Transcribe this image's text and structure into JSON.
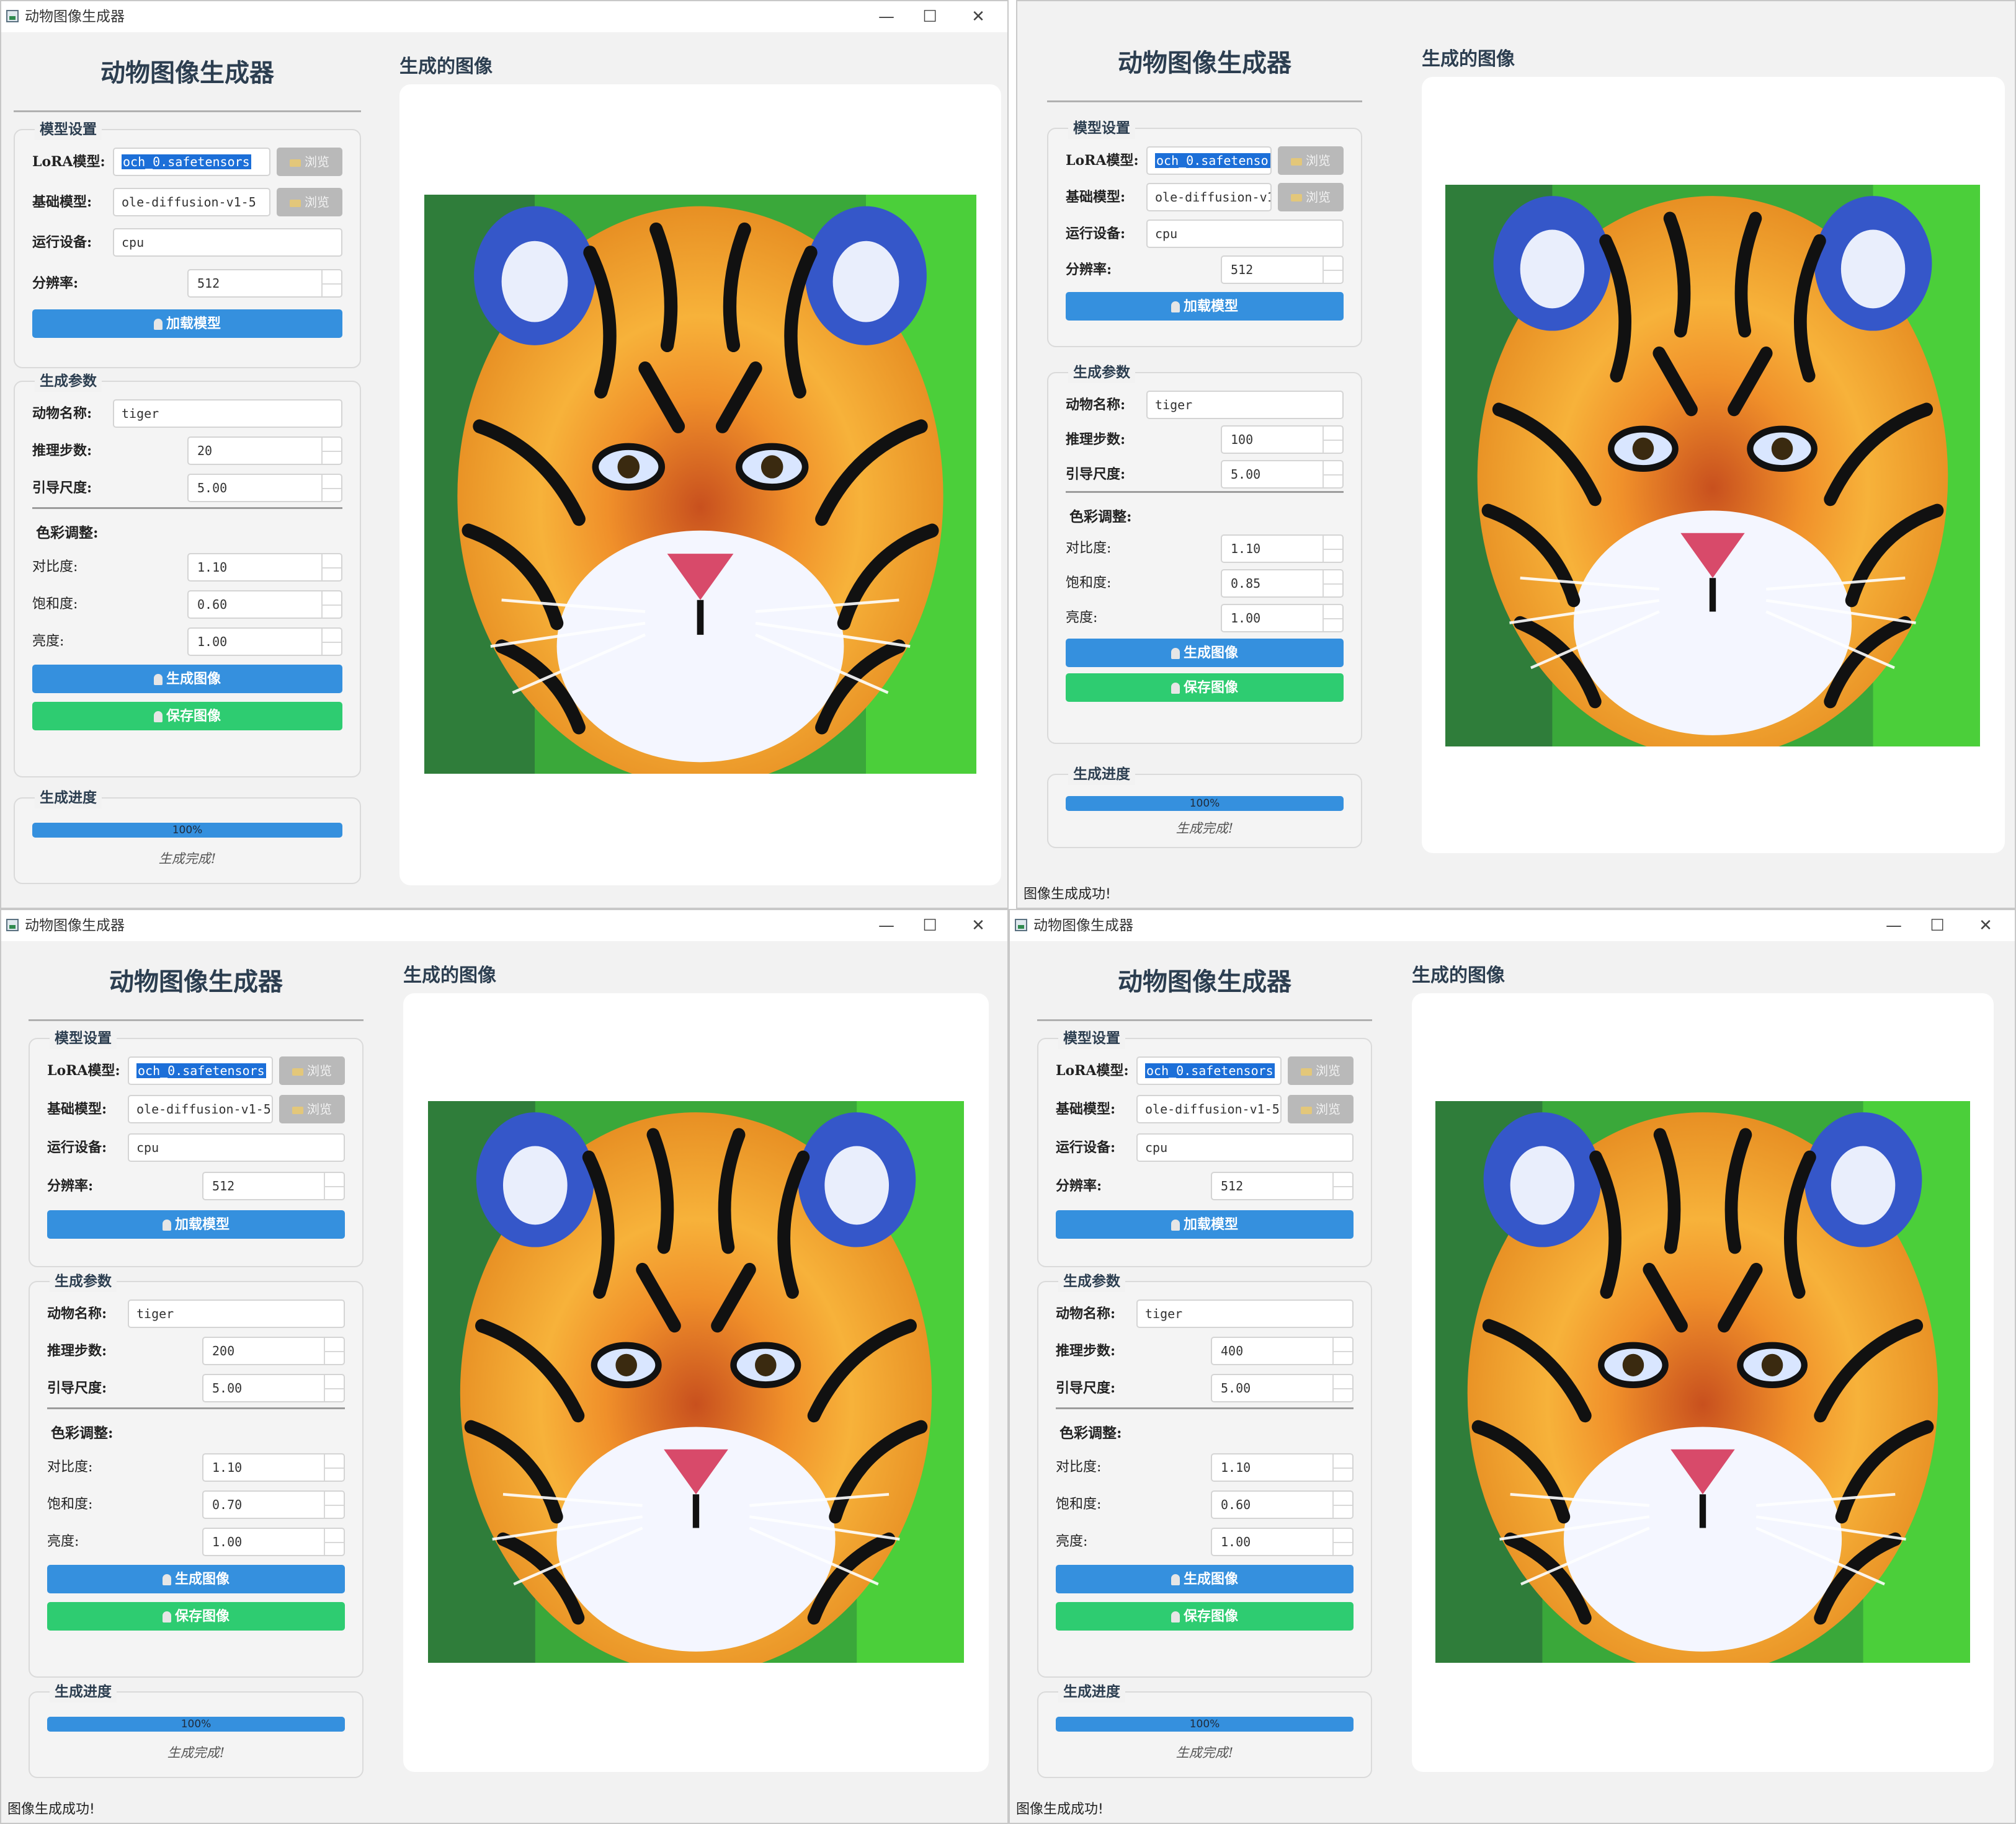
{
  "app": {
    "window_title": "动物图像生成器",
    "panel_title": "动物图像生成器",
    "image_title": "生成的图像",
    "minimize": "—",
    "maximize": "☐",
    "close": "✕"
  },
  "labels": {
    "model_group": "模型设置",
    "lora": "LoRA模型:",
    "base": "基础模型:",
    "device": "运行设备:",
    "resolution": "分辨率:",
    "browse": "浏览",
    "load_model": "加载模型",
    "gen_group": "生成参数",
    "animal": "动物名称:",
    "steps": "推理步数:",
    "guidance": "引导尺度:",
    "color_adjust": "色彩调整:",
    "contrast": "对比度:",
    "saturation": "饱和度:",
    "brightness": "亮度:",
    "generate": "生成图像",
    "save": "保存图像",
    "progress_group": "生成进度"
  },
  "windows": [
    {
      "lora_value": "och_0.safetensors",
      "base_value": "ole-diffusion-v1-5",
      "device_value": "cpu",
      "resolution_value": "512",
      "animal_value": "tiger",
      "steps_value": "20",
      "guidance_value": "5.00",
      "contrast_value": "1.10",
      "saturation_value": "0.60",
      "brightness_value": "1.00",
      "progress": 100,
      "progress_text": "100%",
      "status_text": "生成完成!",
      "statusbar_text": ""
    },
    {
      "lora_value": "och_0.safetensors",
      "base_value": "ole-diffusion-v1-5",
      "device_value": "cpu",
      "resolution_value": "512",
      "animal_value": "tiger",
      "steps_value": "100",
      "guidance_value": "5.00",
      "contrast_value": "1.10",
      "saturation_value": "0.85",
      "brightness_value": "1.00",
      "progress": 100,
      "progress_text": "100%",
      "status_text": "生成完成!",
      "statusbar_text": "图像生成成功!"
    },
    {
      "lora_value": "och_0.safetensors",
      "base_value": "ole-diffusion-v1-5",
      "device_value": "cpu",
      "resolution_value": "512",
      "animal_value": "tiger",
      "steps_value": "200",
      "guidance_value": "5.00",
      "contrast_value": "1.10",
      "saturation_value": "0.70",
      "brightness_value": "1.00",
      "progress": 100,
      "progress_text": "100%",
      "status_text": "生成完成!",
      "statusbar_text": "图像生成成功!"
    },
    {
      "lora_value": "och_0.safetensors",
      "base_value": "ole-diffusion-v1-5",
      "device_value": "cpu",
      "resolution_value": "512",
      "animal_value": "tiger",
      "steps_value": "400",
      "guidance_value": "5.00",
      "contrast_value": "1.10",
      "saturation_value": "0.60",
      "brightness_value": "1.00",
      "progress": 100,
      "progress_text": "100%",
      "status_text": "生成完成!",
      "statusbar_text": "图像生成成功!"
    }
  ],
  "colors": {
    "primary_blue": "#3590de",
    "save_green": "#2ecc71",
    "title_text": "#2c3e50",
    "selection": "#1c6fd8"
  },
  "icons": [
    "folder-icon",
    "gear-icon",
    "generate-icon",
    "save-icon",
    "minimize-icon",
    "maximize-icon",
    "close-icon",
    "app-icon"
  ]
}
